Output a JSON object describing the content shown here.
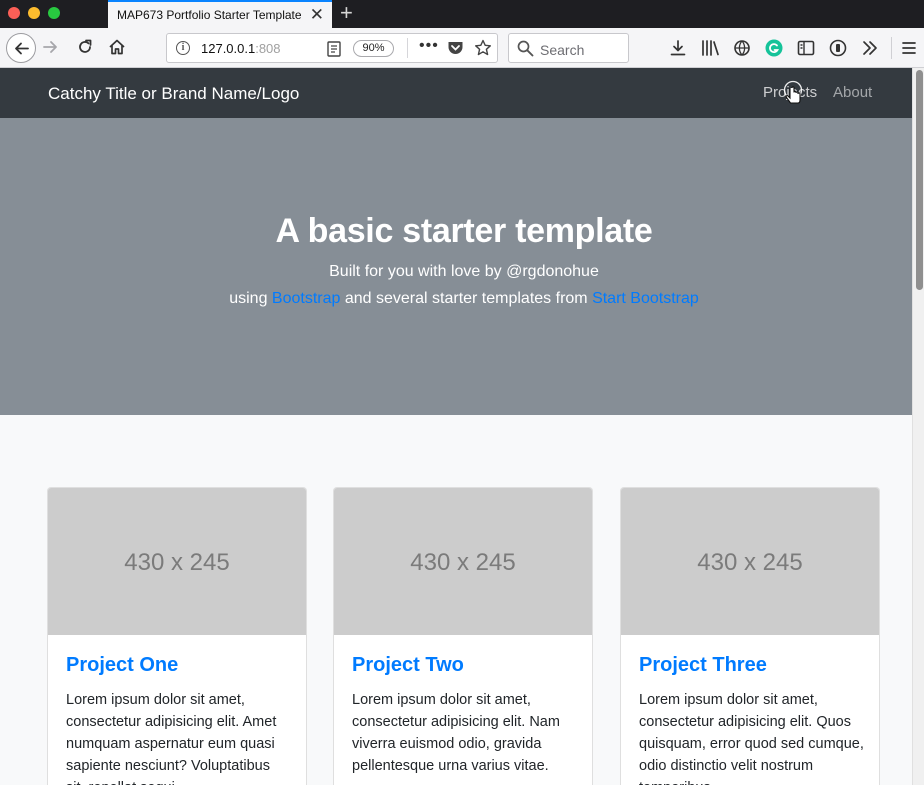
{
  "browser": {
    "tab_title": "MAP673 Portfolio Starter Template",
    "url_host": "127.0.0.1",
    "url_port": ":808",
    "zoom": "90%",
    "search_placeholder": "Search"
  },
  "site": {
    "brand": "Catchy Title or Brand Name/Logo",
    "nav": [
      "Projects",
      "About"
    ],
    "hero": {
      "title": "A basic starter template",
      "line1": "Built for you with love by @rgdonohue",
      "line2_prefix": "using ",
      "link1": "Bootstrap",
      "line2_middle": " and several starter templates from ",
      "link2": "Start Bootstrap"
    },
    "cards": [
      {
        "image_label": "430 x 245",
        "title": "Project One",
        "text": "Lorem ipsum dolor sit amet, consectetur adipisicing elit. Amet numquam aspernatur eum quasi sapiente nesciunt? Voluptatibus sit, repellat sequi"
      },
      {
        "image_label": "430 x 245",
        "title": "Project Two",
        "text": "Lorem ipsum dolor sit amet, consectetur adipisicing elit. Nam viverra euismod odio, gravida pellentesque urna varius vitae."
      },
      {
        "image_label": "430 x 245",
        "title": "Project Three",
        "text": "Lorem ipsum dolor sit amet, consectetur adipisicing elit. Quos quisquam, error quod sed cumque, odio distinctio velit nostrum temporibus"
      }
    ]
  },
  "colors": {
    "navbar": "#343a40",
    "hero": "#868e96",
    "link": "#007bff",
    "tab_accent": "#0a84ff"
  },
  "icons": [
    "back-icon",
    "forward-icon",
    "reload-icon",
    "home-icon",
    "info-icon",
    "reader-icon",
    "more-icon",
    "pocket-icon",
    "star-icon",
    "search-icon",
    "download-icon",
    "library-icon",
    "vpn-icon",
    "grammarly-icon",
    "sidebar-icon",
    "privacy-icon",
    "overflow-icon",
    "menu-icon",
    "hand-cursor-icon"
  ]
}
